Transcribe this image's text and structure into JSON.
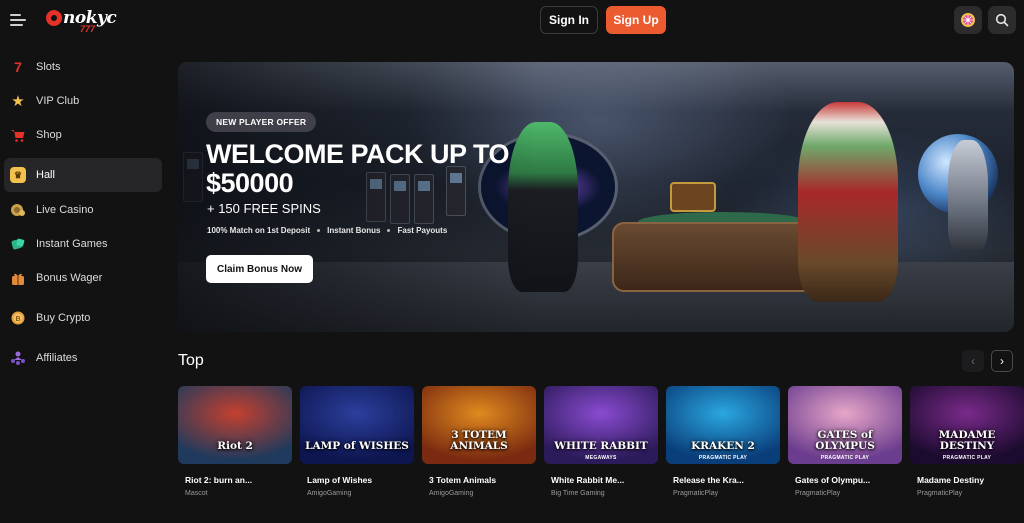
{
  "header": {
    "logo_text": "nokyc",
    "logo_sub": "777",
    "sign_in": "Sign In",
    "sign_up": "Sign Up",
    "accent": "#ec5b2f"
  },
  "sidebar": {
    "items": [
      {
        "label": "Slots",
        "icon": "slot-machine-icon",
        "active": false
      },
      {
        "label": "VIP Club",
        "icon": "star-icon",
        "active": false
      },
      {
        "label": "Shop",
        "icon": "cart-icon",
        "active": false
      },
      {
        "label": "Hall",
        "icon": "ticket-icon",
        "active": true
      },
      {
        "label": "Live Casino",
        "icon": "chips-icon",
        "active": false
      },
      {
        "label": "Instant Games",
        "icon": "dice-icon",
        "active": false
      },
      {
        "label": "Bonus Wager",
        "icon": "gift-icon",
        "active": false
      },
      {
        "label": "Buy Crypto",
        "icon": "coin-icon",
        "active": false
      },
      {
        "label": "Affiliates",
        "icon": "users-icon",
        "active": false
      }
    ]
  },
  "banner": {
    "badge": "NEW PLAYER OFFER",
    "headline_line1": "WELCOME PACK UP TO",
    "headline_line2": "$50000",
    "subline": "+ 150 FREE SPINS",
    "features": [
      "100% Match on 1st Deposit",
      "Instant Bonus",
      "Fast Payouts"
    ],
    "cta": "Claim Bonus Now"
  },
  "top": {
    "title": "Top",
    "games": [
      {
        "name": "Riot 2: burn an...",
        "provider": "Mascot",
        "thumb_title": "Riot 2",
        "thumb_sub": "",
        "color1": "#c4402f",
        "color2": "#1f3a5c"
      },
      {
        "name": "Lamp of Wishes",
        "provider": "AmigoGaming",
        "thumb_title": "LAMP of WISHES",
        "thumb_sub": "",
        "color1": "#2b3f9c",
        "color2": "#0e1650"
      },
      {
        "name": "3 Totem Animals",
        "provider": "AmigoGaming",
        "thumb_title": "3 TOTEM ANIMALS",
        "thumb_sub": "",
        "color1": "#e08a1f",
        "color2": "#7a2a10"
      },
      {
        "name": "White Rabbit Me...",
        "provider": "Big Time Gaming",
        "thumb_title": "WHITE RABBIT",
        "thumb_sub": "MEGAWAYS",
        "color1": "#8a4bd1",
        "color2": "#2c1b5a"
      },
      {
        "name": "Release the Kra...",
        "provider": "PragmaticPlay",
        "thumb_title": "KRAKEN 2",
        "thumb_sub": "PRAGMATIC PLAY",
        "color1": "#2aa7e0",
        "color2": "#0a3e7a"
      },
      {
        "name": "Gates of Olympu...",
        "provider": "PragmaticPlay",
        "thumb_title": "GATES of OLYMPUS",
        "thumb_sub": "PRAGMATIC PLAY",
        "color1": "#e7a6c9",
        "color2": "#6b3d8e"
      },
      {
        "name": "Madame Destiny",
        "provider": "PragmaticPlay",
        "thumb_title": "MADAME DESTINY",
        "thumb_sub": "PRAGMATIC PLAY",
        "color1": "#7a2a8a",
        "color2": "#1b0b2e"
      }
    ]
  }
}
